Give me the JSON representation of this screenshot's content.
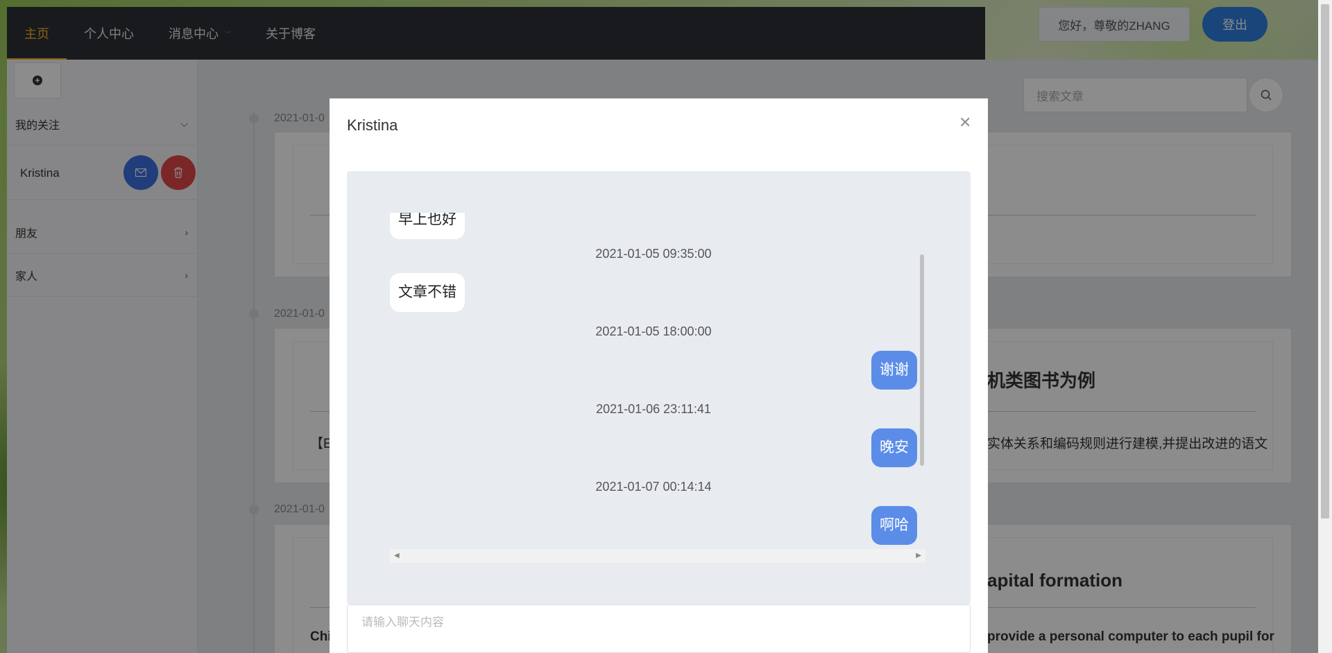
{
  "nav": {
    "items": [
      {
        "label": "主页"
      },
      {
        "label": "个人中心"
      },
      {
        "label": "消息中心"
      },
      {
        "label": "关于博客"
      }
    ],
    "greeting": "您好，尊敬的ZHANG",
    "logout": "登出"
  },
  "sidebar": {
    "add_icon": "plus-circle-icon",
    "sections": [
      {
        "label": "我的关注",
        "icon": "chevron-down-icon"
      },
      {
        "label": "朋友",
        "icon": "chevron-right-icon"
      },
      {
        "label": "家人",
        "icon": "chevron-right-icon"
      }
    ],
    "follow": {
      "name": "Kristina",
      "mail_icon": "mail-icon",
      "delete_icon": "trash-icon"
    }
  },
  "search": {
    "placeholder": "搜索文章",
    "icon": "search-icon"
  },
  "timeline": {
    "entries": [
      {
        "date": "2021-01-0"
      },
      {
        "date": "2021-01-0",
        "title": "机类图书为例",
        "text": "【E",
        "text_right": "实体关系和编码规则进行建模,并提出改进的语文"
      },
      {
        "date": "2021-01-0",
        "title": "apital formation",
        "text": "Chi",
        "text_right": "provide a personal computer to each pupil for"
      }
    ]
  },
  "dialog": {
    "title": "Kristina",
    "close_icon": "close-icon",
    "messages": [
      {
        "side": "left",
        "text": "早上也好"
      },
      {
        "time": "2021-01-05 09:35:00"
      },
      {
        "side": "left",
        "text": "文章不错"
      },
      {
        "time": "2021-01-05 18:00:00"
      },
      {
        "side": "right",
        "text": "谢谢"
      },
      {
        "time": "2021-01-06 23:11:41"
      },
      {
        "side": "right",
        "text": "晚安"
      },
      {
        "time": "2021-01-07 00:14:14"
      },
      {
        "side": "right",
        "text": "啊哈"
      }
    ],
    "input_placeholder": "请输入聊天内容"
  },
  "colors": {
    "nav_bg": "#2f3136",
    "nav_active": "#f3b32c",
    "primary": "#2f7fe0",
    "danger": "#e04848",
    "bubble_right": "#5b8de8"
  }
}
